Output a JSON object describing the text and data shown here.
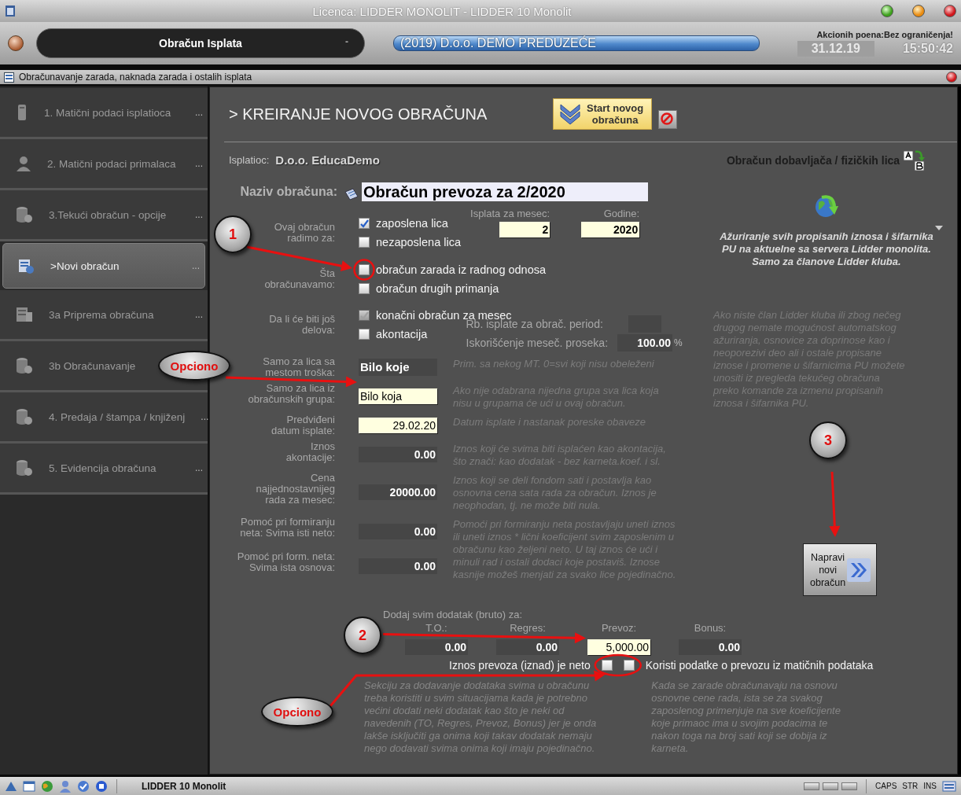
{
  "window": {
    "title": "Licenca: LIDDER MONOLIT - LIDDER 10 Monolit"
  },
  "header": {
    "module": "Obračun Isplata",
    "module_marker": "-",
    "company": "(2019) D.o.o. DEMO PREDUZEĆE",
    "points": "Akcionih poena:Bez ograničenja!",
    "date": "31.12.19",
    "time": "15:50:42"
  },
  "subwindow": {
    "title": "Obračunavanje zarada, naknada zarada i ostalih isplata"
  },
  "sidebar": {
    "items": [
      {
        "label": "1. Matični podaci isplatioca",
        "more": "...",
        "selected": false
      },
      {
        "label": "2. Matični podaci primalaca",
        "more": "...",
        "selected": false
      },
      {
        "label": "3.Tekući obračun - opcije",
        "more": "...",
        "selected": false
      },
      {
        "label": ">Novi obračun",
        "more": "...",
        "selected": true
      },
      {
        "label": "3a Priprema obračuna",
        "more": "...",
        "selected": false
      },
      {
        "label": "3b Obračunavanje",
        "selected": false
      },
      {
        "label": "4. Predaja / štampa / knjiženj",
        "more": "...",
        "selected": false
      },
      {
        "label": "5. Evidencija obračuna",
        "more": "...",
        "selected": false
      }
    ]
  },
  "main": {
    "heading": "> KREIRANJE NOVOG OBRAČUNA",
    "start_button": "Start novog\nobračuna",
    "payer_label": "Isplatioc:",
    "payer": "D.o.o. EducaDemo",
    "name_label": "Naziv obračuna:",
    "name_value": "Obračun prevoza za 2/2020",
    "for_label": "Ovaj obračun\nradimo za:",
    "for_options": [
      {
        "label": "zaposlena lica",
        "checked": true,
        "disabled": false
      },
      {
        "label": "nezaposlena lica",
        "checked": false,
        "disabled": false
      }
    ],
    "month_label": "Isplata za mesec:",
    "month": "2",
    "year_label": "Godine:",
    "year": "2020",
    "what_label": "Šta\nobračunavamo:",
    "what_options": [
      {
        "label": "obračun zarada iz radnog odnosa",
        "checked": false,
        "disabled": false
      },
      {
        "label": "obračun drugih primanja",
        "checked": false,
        "disabled": false
      }
    ],
    "parts_label": "Da li će biti još\ndelova:",
    "parts_options": [
      {
        "label": "konačni obračun za mesec",
        "checked": true,
        "disabled": true
      },
      {
        "label": "akontacija",
        "checked": false,
        "disabled": false
      }
    ],
    "period_label": "Rb. isplate za obrač. period:",
    "usage_label": "Iskorišćenje meseč. proseka:",
    "usage": "100.00",
    "usage_unit": "%",
    "rows": [
      {
        "label": "Samo za lica sa\nmestom troška:",
        "value": "Bilo koje",
        "kind": "choice",
        "hint": "Prim. sa nekog MT. 0=svi koji nisu obeleženi"
      },
      {
        "label": "Samo za lica iz\nobračunskih grupa:",
        "value": "Bilo koja",
        "kind": "choice_entry",
        "hint": "Ako nije odabrana nijedna grupa sva lica koja\nnisu u grupama će ući u ovaj obračun."
      },
      {
        "label": "Predviđeni\ndatum isplate:",
        "value": "29.02.20",
        "kind": "entry",
        "hint": "Datum isplate i nastanak poreske obaveze"
      },
      {
        "label": "Iznos\nakontacije:",
        "value": "0.00",
        "kind": "amount",
        "hint": "Iznos koji će svima biti isplaćen kao akontacija,\nšto znači: kao dodatak - bez karneta.koef. i sl."
      },
      {
        "label": "Cena\nnajjednostavnijeg\nrada za mesec:",
        "value": "20000.00",
        "kind": "amount",
        "hint": "Iznos koji se deli fondom sati i postavlja kao\nosnovna cena sata rada za obračun. Iznos je\nneophodan, tj. ne može biti nula."
      },
      {
        "label": "Pomoć pri formiranju\nneta: Svima isti neto:",
        "value": "0.00",
        "kind": "amount",
        "hint": "Pomoći pri formiranju neta postavljaju uneti iznos\nili uneti iznos * lični koeficijent svim zaposlenim u\nobračunu kao željeni neto. U taj iznos će ući i\nminuli rad i ostali dodaci koje postaviš. Iznose\nkasnije možeš menjati za svako lice pojedinačno."
      },
      {
        "label": "Pomoć pri form. neta:\nSvima ista osnova:",
        "value": "0.00",
        "kind": "amount"
      }
    ],
    "supplier_label": "Obračun dobavljača / fizičkih lica",
    "update_text": "Ažuriranje svih propisanih iznosa i šifarnika\nPU na aktuelne sa servera Lidder monolita.\nSamo za članove Lidder kluba.",
    "info_text": "Ako niste član Lidder kluba ili zbog nečeg\ndrugog nemate mogućnost automatskog\nažuriranja, osnovice za doprinose kao i\nneoporezivi deo ali i ostale propisane\niznose i promene u šifarnicima PU možete\nunositi iz pregleda tekućeg obračuna\npreko komande za izmenu propisanih\niznosa i šifarnika PU.",
    "make_button": "Napravi\nnovi\nobračun",
    "bonus_title": "Dodaj svim dodatak (bruto) za:",
    "bonuses": [
      {
        "label": "T.O.:",
        "value": "0.00",
        "kind": "amount"
      },
      {
        "label": "Regres:",
        "value": "0.00",
        "kind": "amount"
      },
      {
        "label": "Prevoz:",
        "value": "5,000.00",
        "kind": "entry"
      },
      {
        "label": "Bonus:",
        "value": "0.00",
        "kind": "amount"
      }
    ],
    "net_label": "Iznos prevoza (iznad) je neto",
    "net_checked": false,
    "use_master_checked": false,
    "use_master_label": "Koristi podatke o prevozu iz matičnih podataka",
    "hints": [
      "Sekciju za dodavanje dodataka svima u obračunu\ntreba koristiti u svim situacijama kada je potrebno\nvećini dodati neki dodatak kao što je neki od\nnavedenih (TO, Regres, Prevoz, Bonus) jer je onda\nlakše isključiti ga onima koji takav dodatak nemaju\nnego dodavati svima onima koji imaju pojedinačno.",
      "Kada se zarade obračunavaju na osnovu\nosnovne cene rada, ista se za svakog\nzaposlenog primenjuje na sve koeficijente\nkoje primaoc ima u svojim podacima te\nnakon toga na broj sati koji se dobija iz\nkarneta."
    ]
  },
  "annotations": [
    {
      "kind": "number",
      "text": "1"
    },
    {
      "kind": "tag",
      "text": "Opciono"
    },
    {
      "kind": "number",
      "text": "3"
    },
    {
      "kind": "number",
      "text": "2"
    },
    {
      "kind": "tag",
      "text": "Opciono"
    }
  ],
  "status_bar": {
    "app": "LIDDER 10 Monolit",
    "keys": [
      "CAPS",
      "STR",
      "INS"
    ]
  }
}
